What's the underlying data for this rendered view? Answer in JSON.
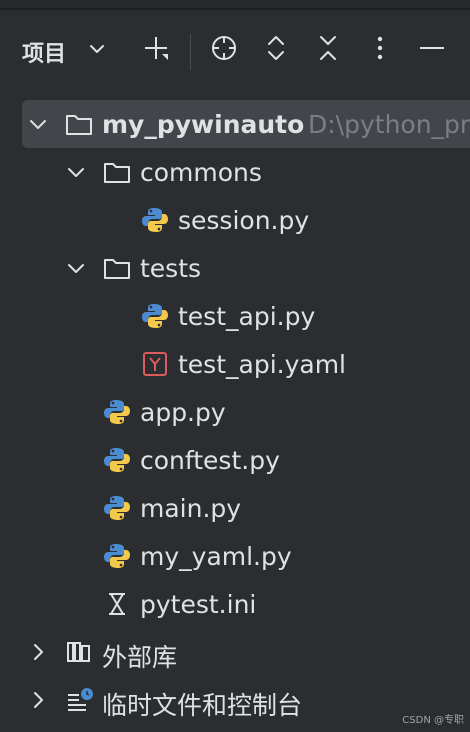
{
  "header": {
    "title": "项目",
    "icons": [
      "chevron-down-icon",
      "add-icon",
      "locate-icon",
      "expand-all-icon",
      "collapse-all-icon",
      "more-icon",
      "minimize-icon"
    ]
  },
  "tree": {
    "root": {
      "name": "my_pywinauto",
      "path": "D:\\python_pr"
    },
    "commons": "commons",
    "session": "session.py",
    "tests": "tests",
    "test_api_py": "test_api.py",
    "test_api_yaml": "test_api.yaml",
    "app": "app.py",
    "conftest": "conftest.py",
    "main": "main.py",
    "my_yaml": "my_yaml.py",
    "pytest_ini": "pytest.ini",
    "external_libs": "外部库",
    "scratches": "临时文件和控制台"
  },
  "colors": {
    "background": "#2b2d30",
    "selection": "#43454a",
    "text": "#dfe1e5",
    "path": "#7a7e85",
    "python_blue": "#4b8bd1",
    "python_yellow": "#f2c94c",
    "yaml_red": "#db5c5c"
  },
  "watermark": "CSDN @专职"
}
